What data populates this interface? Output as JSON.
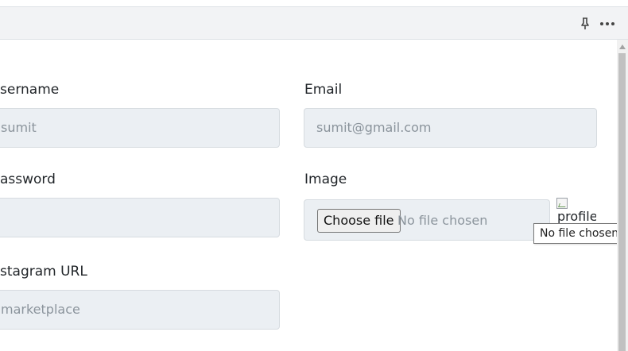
{
  "toolbar": {
    "pin_icon": "pin-icon",
    "more_icon": "more-horizontal-icon"
  },
  "form": {
    "username": {
      "label": "sername",
      "value": "sumit"
    },
    "email": {
      "label": "Email",
      "placeholder": "sumit@gmail.com"
    },
    "password": {
      "label": "assword",
      "value": ""
    },
    "image": {
      "label": "Image",
      "button_label": "Choose file",
      "status_text": "No file chosen",
      "preview_alt": "profile"
    },
    "instagram": {
      "label": "stagram URL",
      "value": "marketplace"
    }
  },
  "tooltip": {
    "text": "No file chosen"
  },
  "colors": {
    "toolbar_bg": "#f2f3f5",
    "input_bg": "#ebeff3",
    "input_text": "#8b949c",
    "scroll_thumb": "#c1c1c1"
  }
}
